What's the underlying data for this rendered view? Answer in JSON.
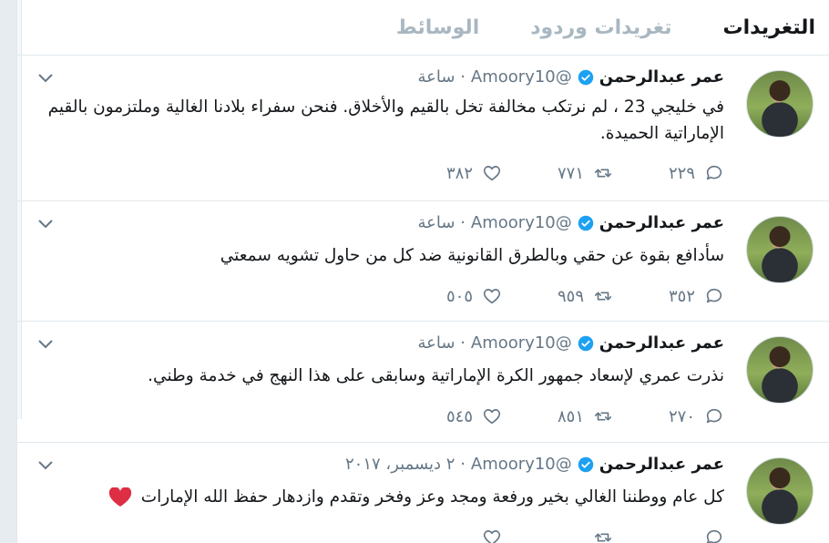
{
  "tabs": [
    {
      "label": "التغريدات",
      "active": true
    },
    {
      "label": "تغريدات وردود",
      "active": false
    },
    {
      "label": "الوسائط",
      "active": false
    }
  ],
  "tweets": [
    {
      "name": "عمر عبدالرحمن",
      "handle": "@Amoory10",
      "time": "· ساعة",
      "text": "في خليجي 23 ، لم نرتكب مخالفة  تخل بالقيم والأخلاق.  فنحن سفراء بلادنا الغالية وملتزمون بالقيم الإماراتية الحميدة.",
      "replies": "٢٢٩",
      "retweets": "٧٧١",
      "likes": "٣٨٢"
    },
    {
      "name": "عمر عبدالرحمن",
      "handle": "@Amoory10",
      "time": "· ساعة",
      "text": "سأدافع بقوة عن حقي وبالطرق القانونية ضد كل من حاول تشويه سمعتي",
      "replies": "٣٥٢",
      "retweets": "٩٥٩",
      "likes": "٥٠٥"
    },
    {
      "name": "عمر عبدالرحمن",
      "handle": "@Amoory10",
      "time": "· ساعة",
      "text": "نذرت عمري لإسعاد جمهور الكرة الإماراتية وسابقى على هذا النهج    في خدمة وطني.",
      "replies": "٢٧٠",
      "retweets": "٨٥١",
      "likes": "٥٤٥"
    },
    {
      "name": "عمر عبدالرحمن",
      "handle": "@Amoory10",
      "time": "· ٢ ديسمبر، ٢٠١٧",
      "text": "كل عام ووطننا الغالي بخير ورفعة ومجد وعز وفخر وتقدم وازدهار  حفظ الله الإمارات",
      "replies": "",
      "retweets": "",
      "likes": ""
    }
  ],
  "colors": {
    "verified": "#1da1f2",
    "heart_emoji": "#dd2e44",
    "muted": "#657786"
  },
  "icons": {
    "reply": "reply-icon",
    "retweet": "retweet-icon",
    "like": "like-icon",
    "verified": "verified-badge-icon",
    "caret": "chevron-down-icon"
  }
}
